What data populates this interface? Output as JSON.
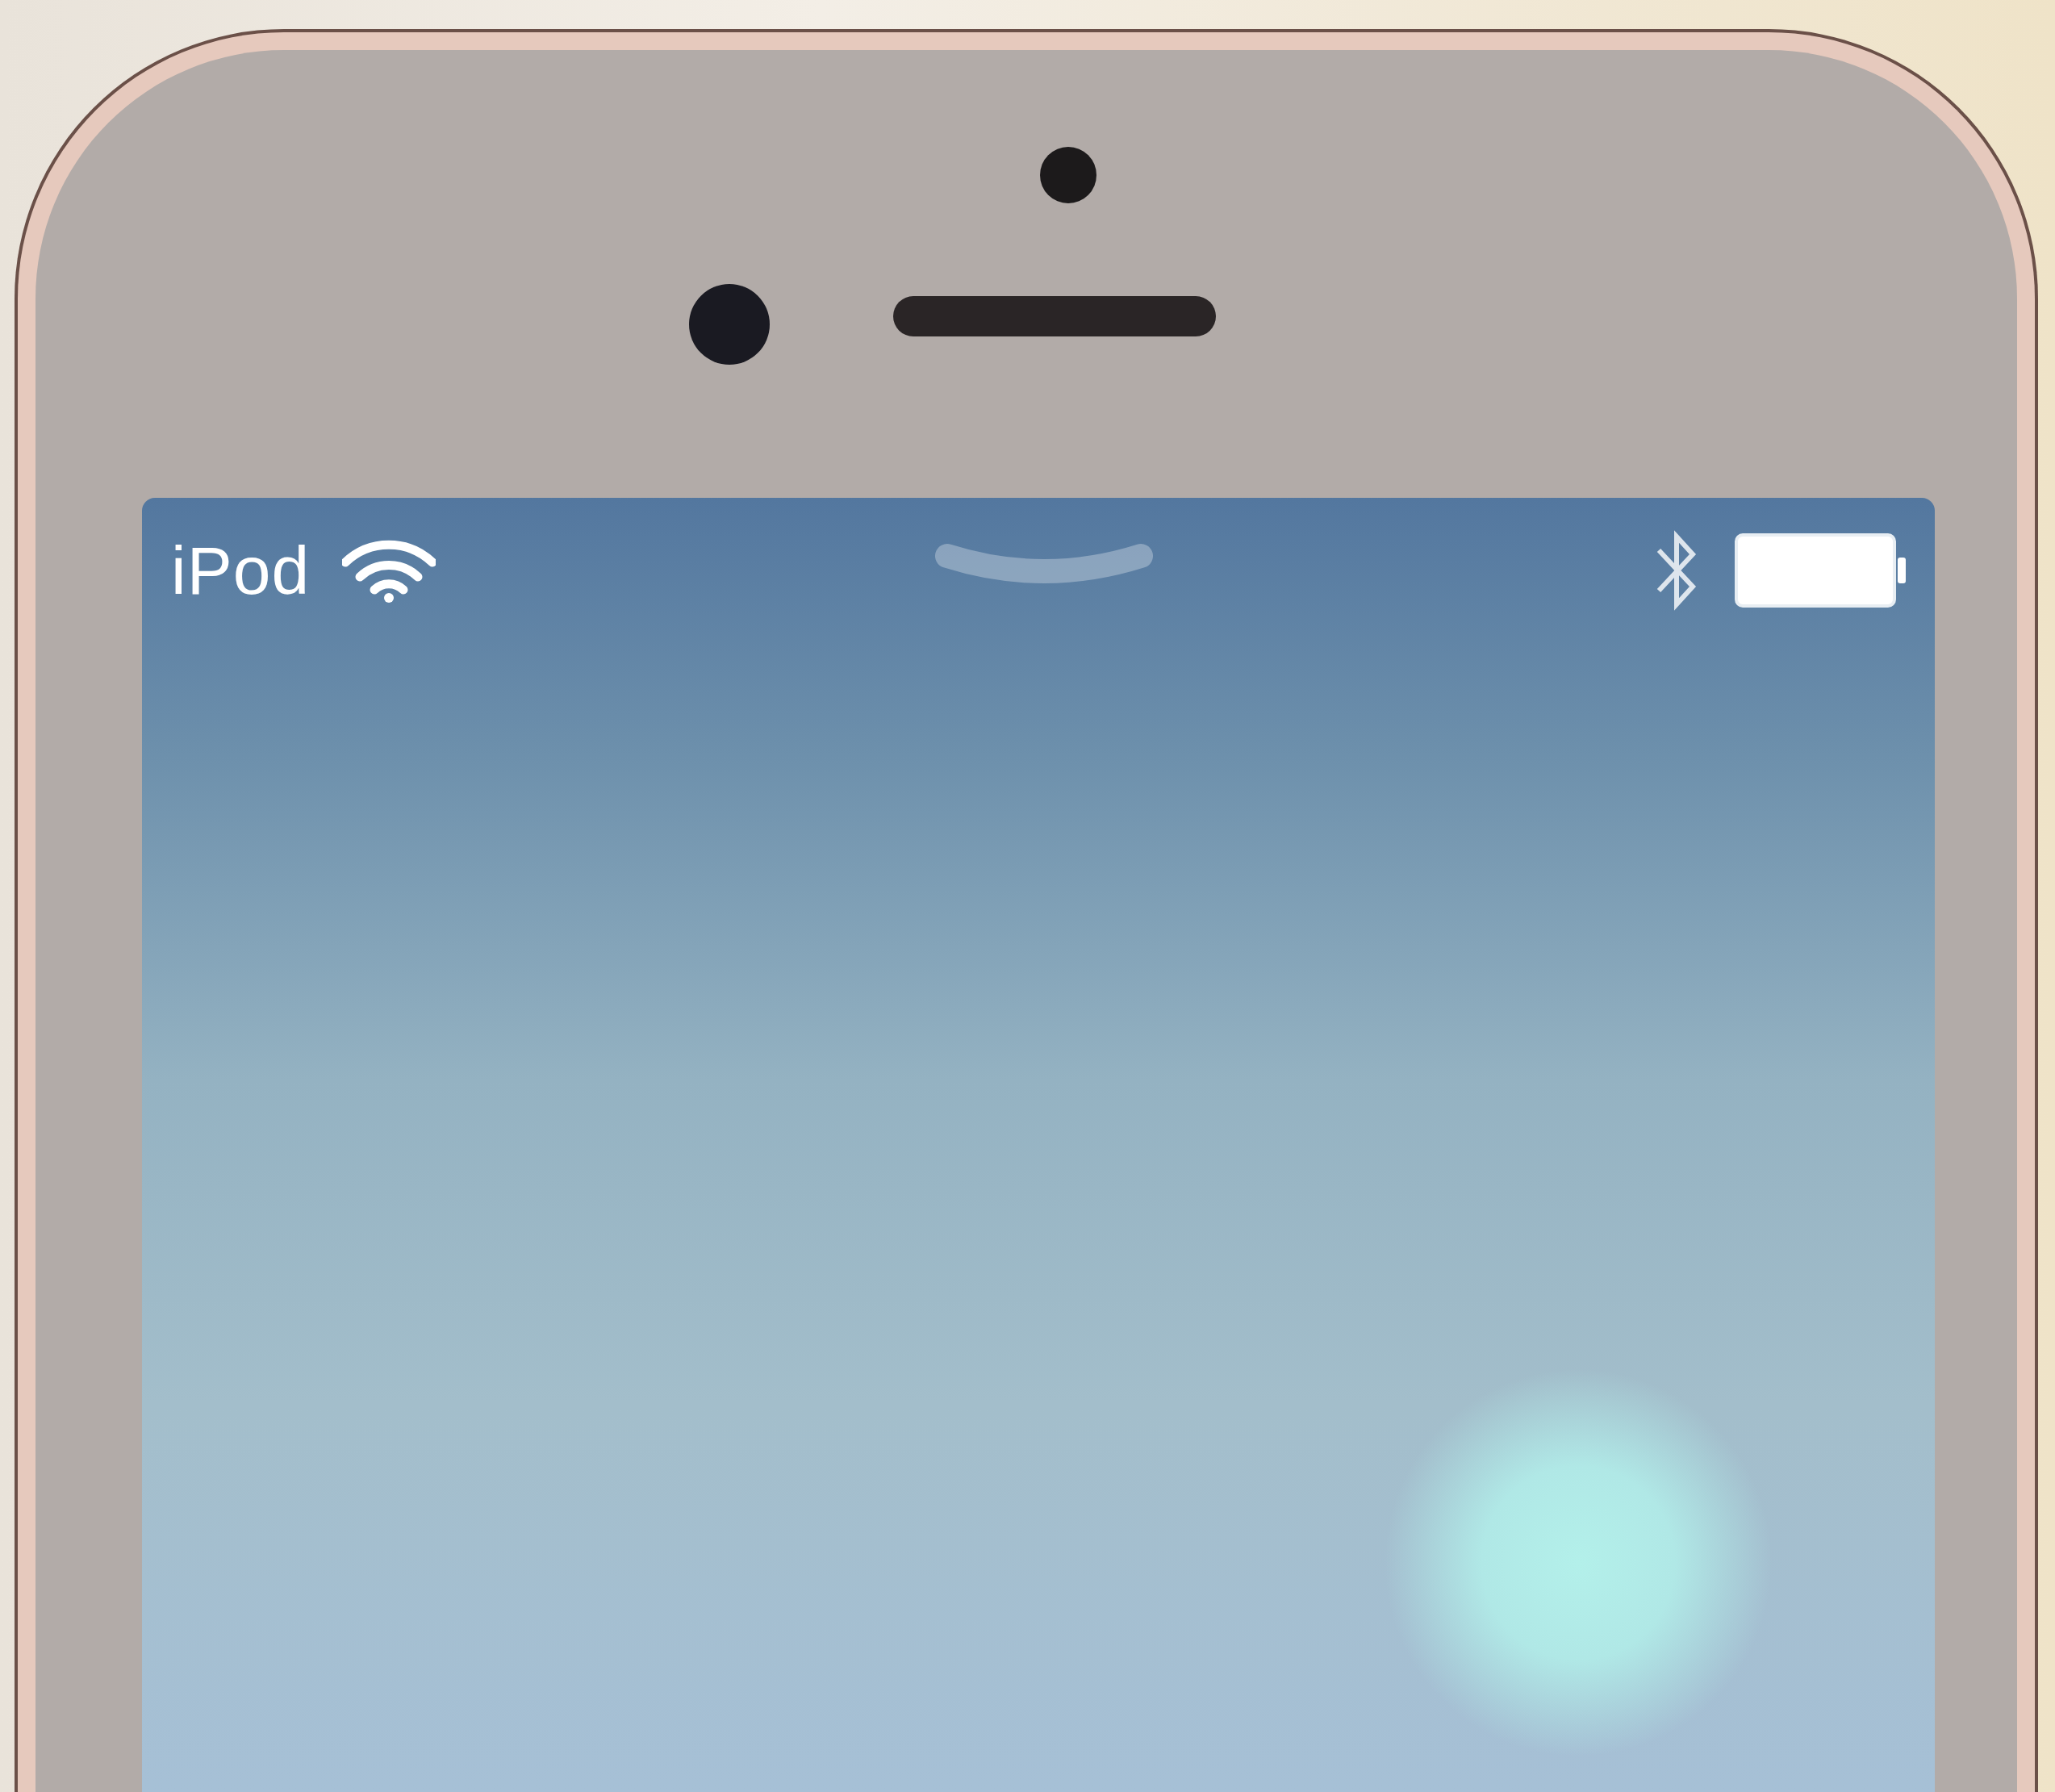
{
  "status_bar": {
    "carrier": "iPod"
  }
}
